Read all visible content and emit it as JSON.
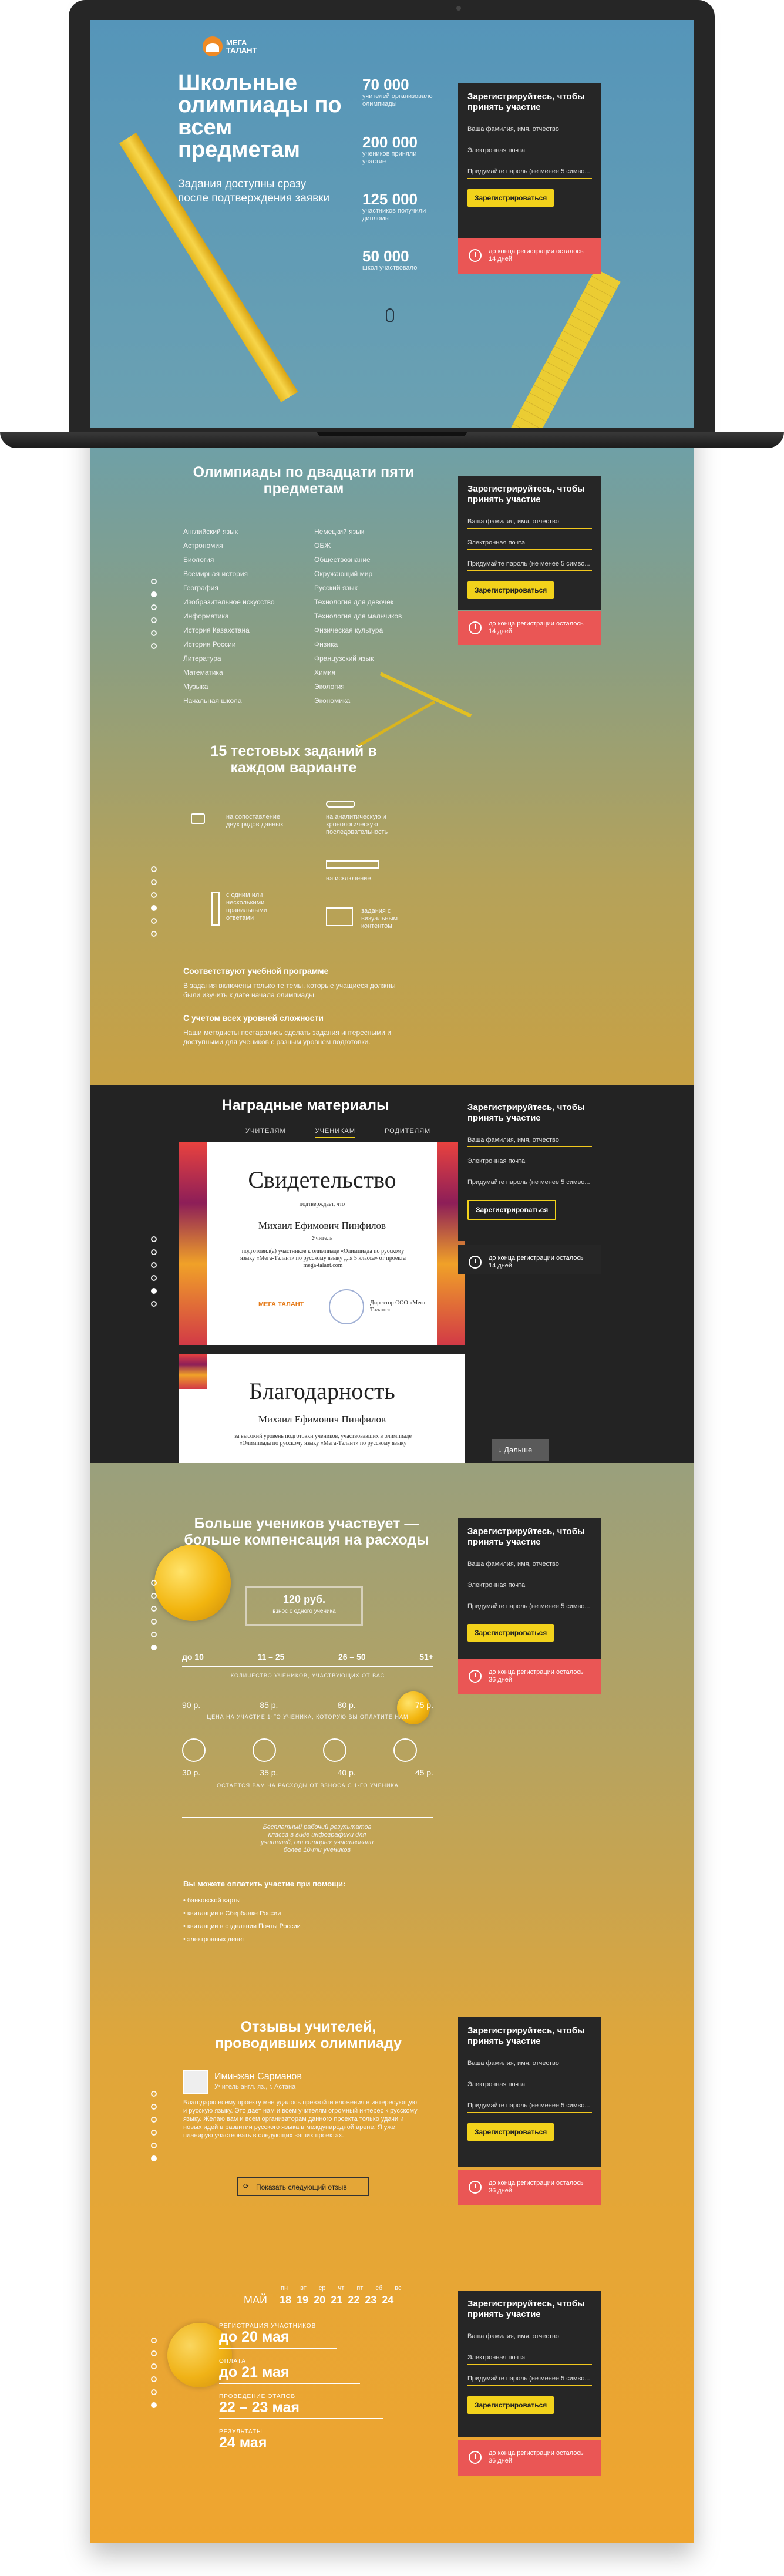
{
  "logo": {
    "text": "МЕГА ТАЛАНТ"
  },
  "hero": {
    "title": "Школьные олимпиады по всем предметам",
    "subtitle": "Задания доступны сразу после подтверждения заявки",
    "stats": [
      {
        "num": "70 000",
        "label": "учителей организовало олимпиады"
      },
      {
        "num": "200 000",
        "label": "учеников приняли участие"
      },
      {
        "num": "125 000",
        "label": "участников получили дипломы"
      },
      {
        "num": "50 000",
        "label": "школ участвовало"
      }
    ]
  },
  "reg": {
    "title": "Зарегистрируйтесь, чтобы принять участие",
    "name_ph": "Ваша фамилия, имя, отчество",
    "email_ph": "Электронная почта",
    "pass_ph": "Придумайте пароль (не менее 5 симво...",
    "btn": "Зарегистрироваться"
  },
  "timers": {
    "t14": "до конца регистрации осталось 14 дней",
    "t36": "до конца регистрации осталось 36 дней"
  },
  "subjects": {
    "title": "Олимпиады по двадцати пяти предметам",
    "left": [
      "Английский язык",
      "Астрономия",
      "Биология",
      "Всемирная история",
      "География",
      "Изобразительное искусство",
      "Информатика",
      "История Казахстана",
      "История России",
      "Литература",
      "Математика",
      "Музыка",
      "Начальная школа"
    ],
    "right": [
      "Немецкий язык",
      "ОБЖ",
      "Обществознание",
      "Окружающий мир",
      "Русский язык",
      "Технология для девочек",
      "Технология для мальчиков",
      "Физическая культура",
      "Физика",
      "Французский язык",
      "Химия",
      "Экология",
      "Экономика"
    ]
  },
  "tests": {
    "title": "15 тестовых заданий в каждом варианте",
    "f1": "на сопоставление двух рядов данных",
    "f2": "на аналитическую и хронологическую последовательность",
    "f3": "на исключение",
    "f4": "с одним или несколькими правильными ответами",
    "f5": "задания с визуальным контентом",
    "h1": "Соответствуют учебной программе",
    "p1": "В задания включены только те темы, которые учащиеся должны были изучить к дате начала олимпиады.",
    "h2": "С учетом всех уровней сложности",
    "p2": "Наши методисты постарались сделать задания интересными и доступными для учеников с разным уровнем подготовки."
  },
  "awards": {
    "title": "Наградные материалы",
    "tabs": [
      "УЧИТЕЛЯМ",
      "УЧЕНИКАМ",
      "РОДИТЕЛЯМ"
    ],
    "cert1": {
      "title": "Свидетельство",
      "sub": "подтверждает, что",
      "name": "Михаил Ефимович Пинфилов",
      "line": "Учитель",
      "body": "подготовил(а) участников к олимпиаде «Олимпиада по русскому языку «Мега-Талант» по русскому языку для 5 класса» от проекта mega-talant.com",
      "org": "Директор ООО «Мега-Талант»"
    },
    "cert2": {
      "title": "Благодарность",
      "name": "Михаил Ефимович Пинфилов",
      "body": "за высокий уровень подготовки учеников, участвовавших в олимпиаде «Олимпиада по русскому языку «Мега-Талант» по русскому языку"
    },
    "more": "Дальше"
  },
  "comp": {
    "title": "Больше учеников участвует — больше компенсация на расходы",
    "fee": "120 руб.",
    "fee_note": "взнос с одного ученика",
    "tiers": [
      "до 10",
      "11 – 25",
      "26 – 50",
      "51+"
    ],
    "tiers_caption": "КОЛИЧЕСТВО УЧЕНИКОВ, УЧАСТВУЮЩИХ ОТ ВАС",
    "row1": [
      "90 р.",
      "85 р.",
      "80 р.",
      "75 р."
    ],
    "row1_caption": "ЦЕНА НА УЧАСТИЕ 1-ГО УЧЕНИКА, КОТОРУЮ ВЫ ОПЛАТИТЕ НАМ",
    "row2": [
      "30 р.",
      "35 р.",
      "40 р.",
      "45 р."
    ],
    "row2_caption": "ОСТАЕТСЯ ВАМ НА РАСХОДЫ ОТ ВЗНОСА С 1-ГО УЧЕНИКА",
    "note": "Бесплатный рабочий результатов класса в виде инфографики для учителей, от которых участвовали более 10-ти учеников",
    "pay_title": "Вы можете оплатить участие при помощи:",
    "pay": [
      "банковской карты",
      "квитанции в Сбербанке России",
      "квитанции в отделении Почты России",
      "электронных денег"
    ]
  },
  "reviews": {
    "title": "Отзывы учителей, проводивших олимпиаду",
    "name": "Иминжан Сарманов",
    "role": "Учитель англ. яз., г. Астана",
    "text": "Благодарю всему проекту мне удалось превзойти вложения в интересующую и русскую языку. Это дает нам и всем учителям огромный интерес к русскому языку. Желаю вам и всем организаторам данного проекта только удачи и новых идей в развитии русского языка в международной арене. Я уже планирую участвовать в следующих ваших проектах.",
    "btn": "Показать следующий отзыв"
  },
  "calendar": {
    "month": "МАЙ",
    "days": [
      "пн",
      "вт",
      "ср",
      "чт",
      "пт",
      "сб",
      "вс"
    ],
    "nums": [
      "18",
      "19",
      "20",
      "21",
      "22",
      "23",
      "24"
    ],
    "d1_label": "РЕГИСТРАЦИЯ УЧАСТНИКОВ",
    "d1": "до 20 мая",
    "d2_label": "ОПЛАТА",
    "d2": "до 21 мая",
    "d3_label": "ПРОВЕДЕНИЕ ЭТАПОВ",
    "d3": "22 – 23 мая",
    "d4_label": "РЕЗУЛЬТАТЫ",
    "d4": "24 мая"
  },
  "colors": {
    "accent": "#f2d21b",
    "red": "#ea5655",
    "dark": "#262626"
  }
}
